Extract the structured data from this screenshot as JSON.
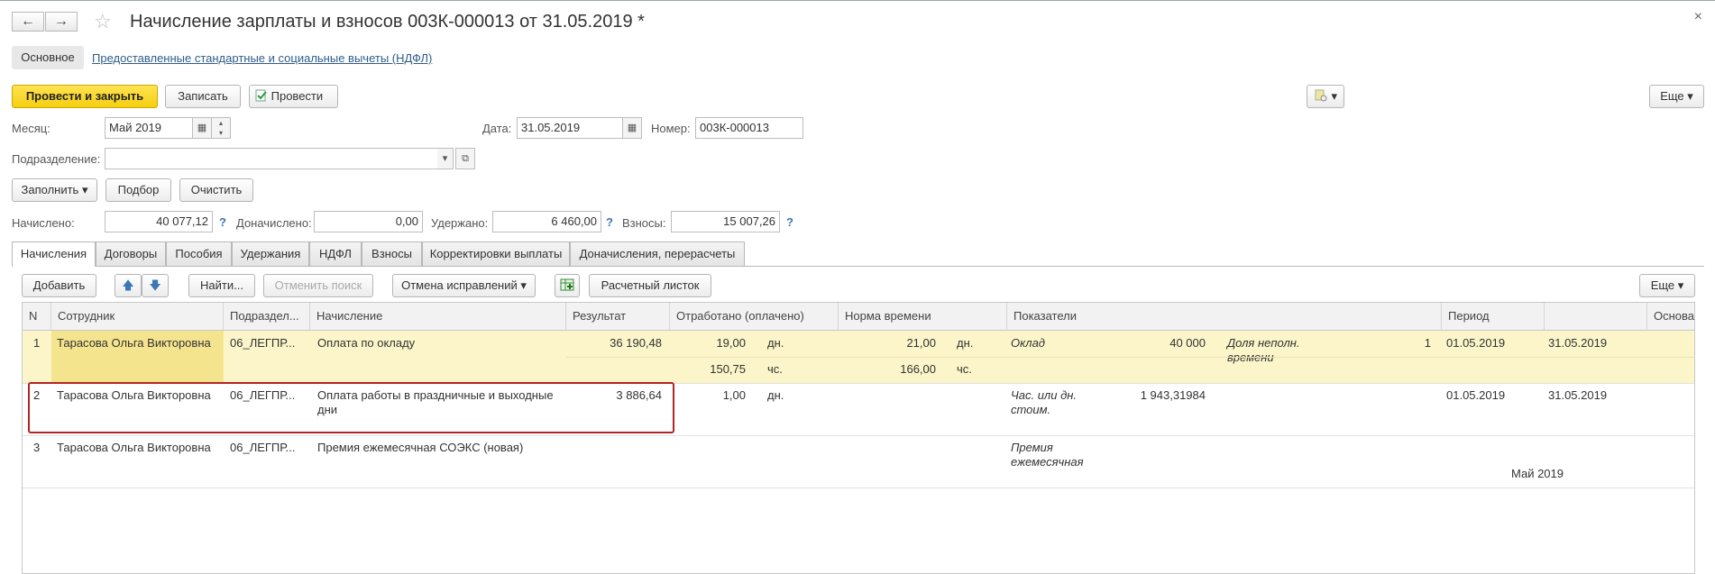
{
  "window": {
    "back_icon": "←",
    "forward_icon": "→",
    "star_icon": "☆",
    "title": "Начисление зарплаты и взносов 003К-000013 от 31.05.2019 *",
    "close_icon": "×"
  },
  "section_tabs": {
    "main": "Основное",
    "deductions_link": "Предоставленные стандартные и социальные вычеты (НДФЛ)"
  },
  "toolbar": {
    "post_close": "Провести и закрыть",
    "save": "Записать",
    "post": "Провести",
    "report_menu": "▾",
    "more": "Еще ▾"
  },
  "header_fields": {
    "month_label": "Месяц:",
    "month_value": "Май 2019",
    "date_label": "Дата:",
    "date_value": "31.05.2019",
    "number_label": "Номер:",
    "number_value": "003К-000013",
    "department_label": "Подразделение:",
    "department_value": ""
  },
  "actions": {
    "fill": "Заполнить ▾",
    "select": "Подбор",
    "clear": "Очистить"
  },
  "totals": {
    "accrued_label": "Начислено:",
    "accrued_value": "40 077,12",
    "extra_label": "Доначислено:",
    "extra_value": "0,00",
    "withheld_label": "Удержано:",
    "withheld_value": "6 460,00",
    "contrib_label": "Взносы:",
    "contrib_value": "15 007,26",
    "help": "?"
  },
  "tabs": [
    {
      "label": "Начисления",
      "active": true
    },
    {
      "label": "Договоры"
    },
    {
      "label": "Пособия"
    },
    {
      "label": "Удержания"
    },
    {
      "label": "НДФЛ"
    },
    {
      "label": "Взносы"
    },
    {
      "label": "Корректировки выплаты"
    },
    {
      "label": "Доначисления, перерасчеты"
    }
  ],
  "table_toolbar": {
    "add": "Добавить",
    "up_icon": "🡅",
    "down_icon": "🡇",
    "find": "Найти...",
    "cancel_search": "Отменить поиск",
    "cancel_corrections": "Отмена исправлений ▾",
    "payslip": "Расчетный листок",
    "more": "Еще ▾"
  },
  "columns": {
    "n": "N",
    "employee": "Сотрудник",
    "department": "Подраздел...",
    "accrual": "Начисление",
    "result": "Результат",
    "worked": "Отработано (оплачено)",
    "norm": "Норма времени",
    "indicators": "Показатели",
    "period": "Период",
    "basis": "Основа..."
  },
  "rows": [
    {
      "n": "1",
      "employee": "Тарасова Ольга Викторовна",
      "department": "06_ЛЕГПР...",
      "accrual": "Оплата по окладу",
      "result": "36 190,48",
      "worked_days": "19,00",
      "worked_days_unit": "дн.",
      "worked_hours": "150,75",
      "worked_hours_unit": "чс.",
      "norm_days": "21,00",
      "norm_days_unit": "дн.",
      "norm_hours": "166,00",
      "norm_hours_unit": "чс.",
      "ind1_name": "Оклад",
      "ind1_value": "40 000",
      "ind2_name_l1": "Доля неполн.",
      "ind2_name_l2": "времени",
      "ind2_value": "1",
      "period_from": "01.05.2019",
      "period_to": "31.05.2019"
    },
    {
      "n": "2",
      "employee": "Тарасова Ольга Викторовна",
      "department": "06_ЛЕГПР...",
      "accrual_l1": "Оплата работы в праздничные и выходные",
      "accrual_l2": "дни",
      "result": "3 886,64",
      "worked_days": "1,00",
      "worked_days_unit": "дн.",
      "ind1_name_l1": "Час. или дн.",
      "ind1_name_l2": "стоим.",
      "ind1_value": "1 943,31984",
      "period_from": "01.05.2019",
      "period_to": "31.05.2019"
    },
    {
      "n": "3",
      "employee": "Тарасова Ольга Викторовна",
      "department": "06_ЛЕГПР...",
      "accrual": "Премия ежемесячная СОЭКС (новая)",
      "ind1_name_l1": "Премия",
      "ind1_name_l2": "ежемесячная",
      "period_month": "Май 2019"
    }
  ]
}
